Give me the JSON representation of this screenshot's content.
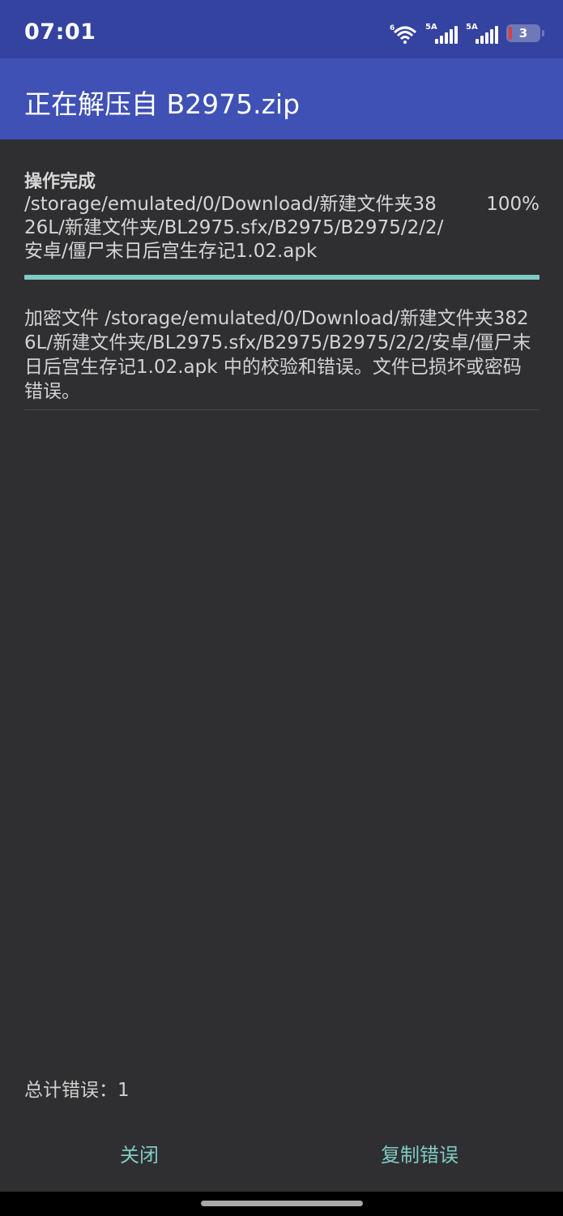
{
  "status_bar": {
    "time": "07:01",
    "signal1_tag": "5A",
    "signal2_tag": "5A",
    "battery_level": "3",
    "icons": [
      "wifi-6-icon",
      "signal-icon",
      "signal-icon",
      "battery-icon"
    ]
  },
  "app_bar": {
    "title": "正在解压自 B2975.zip"
  },
  "operation": {
    "status": "操作完成",
    "path": "/storage/emulated/0/Download/新建文件夹3826L/新建文件夹/BL2975.sfx/B2975/B2975/2/2/安卓/僵尸末日后宫生存记1.02.apk",
    "percent_label": "100%",
    "progress_fraction": 1.0
  },
  "errors": {
    "messages": [
      "加密文件 /storage/emulated/0/Download/新建文件夹3826L/新建文件夹/BL2975.sfx/B2975/B2975/2/2/安卓/僵尸末日后宫生存记1.02.apk 中的校验和错误。文件已损坏或密码错误。"
    ],
    "total_label": "总计错误：1"
  },
  "buttons": {
    "close": "关闭",
    "copy_errors": "复制错误"
  },
  "colors": {
    "status_bar": "#3442a0",
    "app_bar": "#3f51b5",
    "background": "#2f2f31",
    "accent": "#80cbc4"
  }
}
